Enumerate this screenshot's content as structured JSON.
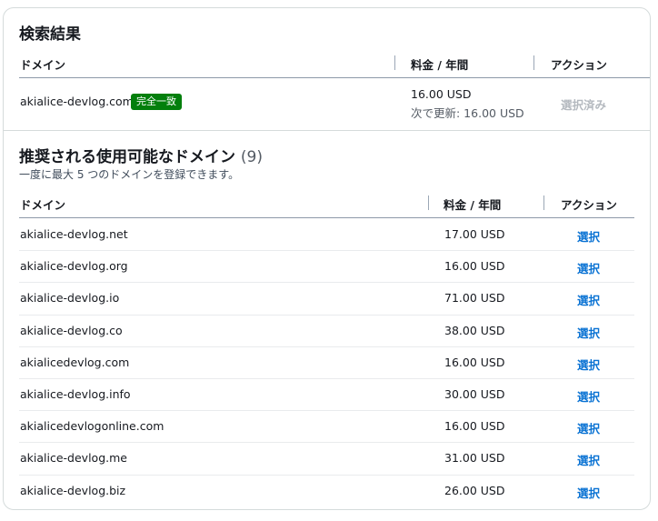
{
  "search_results": {
    "title": "検索結果",
    "columns": {
      "domain": "ドメイン",
      "price": "料金 / 年間",
      "action": "アクション"
    },
    "row": {
      "domain": "akialice-devlog.com",
      "badge": "完全一致",
      "price": "16.00 USD",
      "renewal": "次で更新: 16.00 USD",
      "action": "選択済み"
    }
  },
  "recommended": {
    "title": "推奨される使用可能なドメイン",
    "count": "(9)",
    "subtitle": "一度に最大 5 つのドメインを登録できます。",
    "columns": {
      "domain": "ドメイン",
      "price": "料金 / 年間",
      "action": "アクション"
    },
    "rows": [
      {
        "domain": "akialice-devlog.net",
        "price": "17.00 USD",
        "action": "選択"
      },
      {
        "domain": "akialice-devlog.org",
        "price": "16.00 USD",
        "action": "選択"
      },
      {
        "domain": "akialice-devlog.io",
        "price": "71.00 USD",
        "action": "選択"
      },
      {
        "domain": "akialice-devlog.co",
        "price": "38.00 USD",
        "action": "選択"
      },
      {
        "domain": "akialicedevlog.com",
        "price": "16.00 USD",
        "action": "選択"
      },
      {
        "domain": "akialice-devlog.info",
        "price": "30.00 USD",
        "action": "選択"
      },
      {
        "domain": "akialicedevlogonline.com",
        "price": "16.00 USD",
        "action": "選択"
      },
      {
        "domain": "akialice-devlog.me",
        "price": "31.00 USD",
        "action": "選択"
      },
      {
        "domain": "akialice-devlog.biz",
        "price": "26.00 USD",
        "action": "選択"
      }
    ]
  }
}
